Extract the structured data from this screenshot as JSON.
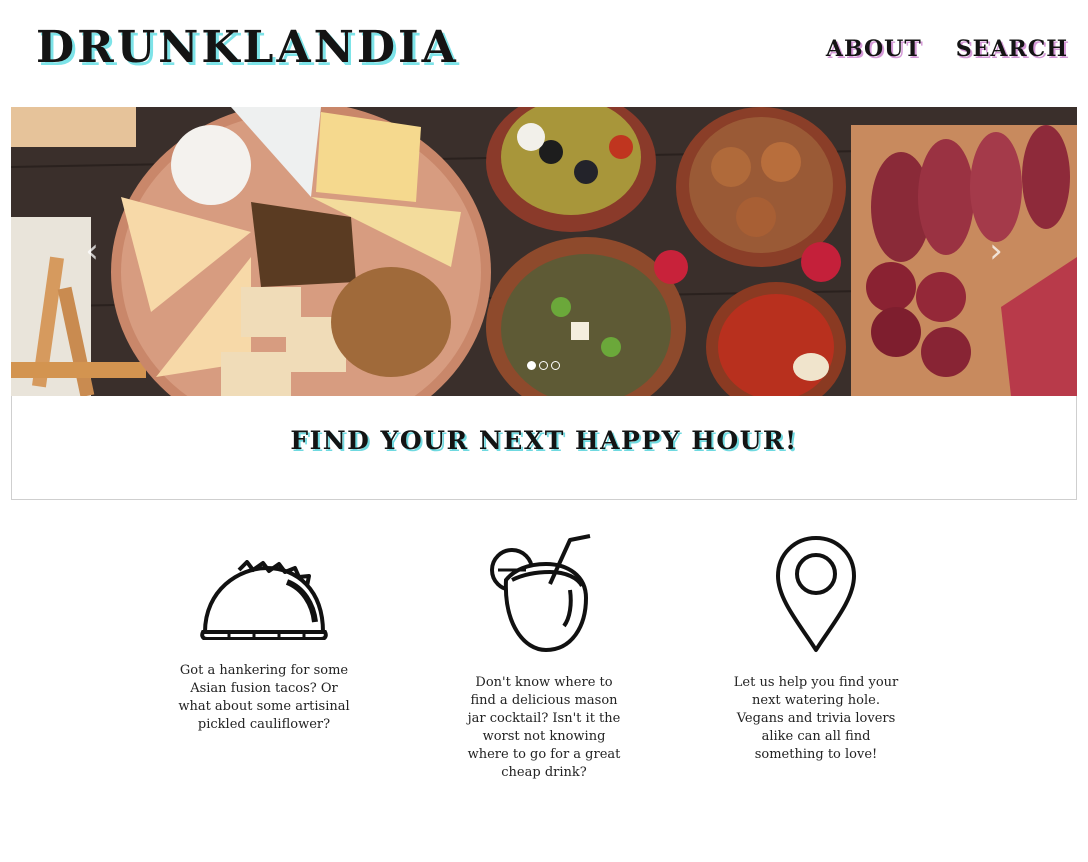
{
  "header": {
    "logo": "DRUNKLANDIA",
    "nav": [
      {
        "label": "ABOUT"
      },
      {
        "label": "SEARCH"
      }
    ]
  },
  "carousel": {
    "prev_icon": "chevron-left-icon",
    "next_icon": "chevron-right-icon",
    "slides_count": 3,
    "active_slide": 1
  },
  "tagline": "FIND YOUR NEXT HAPPY HOUR!",
  "features": [
    {
      "icon": "taco-icon",
      "text": "Got a hankering for some Asian fusion tacos? Or what about some artisinal pickled cauliflower?"
    },
    {
      "icon": "cocktail-icon",
      "text": "Don't know where to find a delicious mason jar cocktail? Isn't it the worst not knowing where to go for a great cheap drink?"
    },
    {
      "icon": "map-pin-icon",
      "text": "Let us help you find your next watering hole. Vegans and trivia lovers alike can all find something to love!"
    }
  ],
  "colors": {
    "logo_shadow": "#7de3e8",
    "nav_shadow": "#d59ad8",
    "tagline_shadow": "#6fd9e0",
    "border": "#cfcfcf"
  }
}
